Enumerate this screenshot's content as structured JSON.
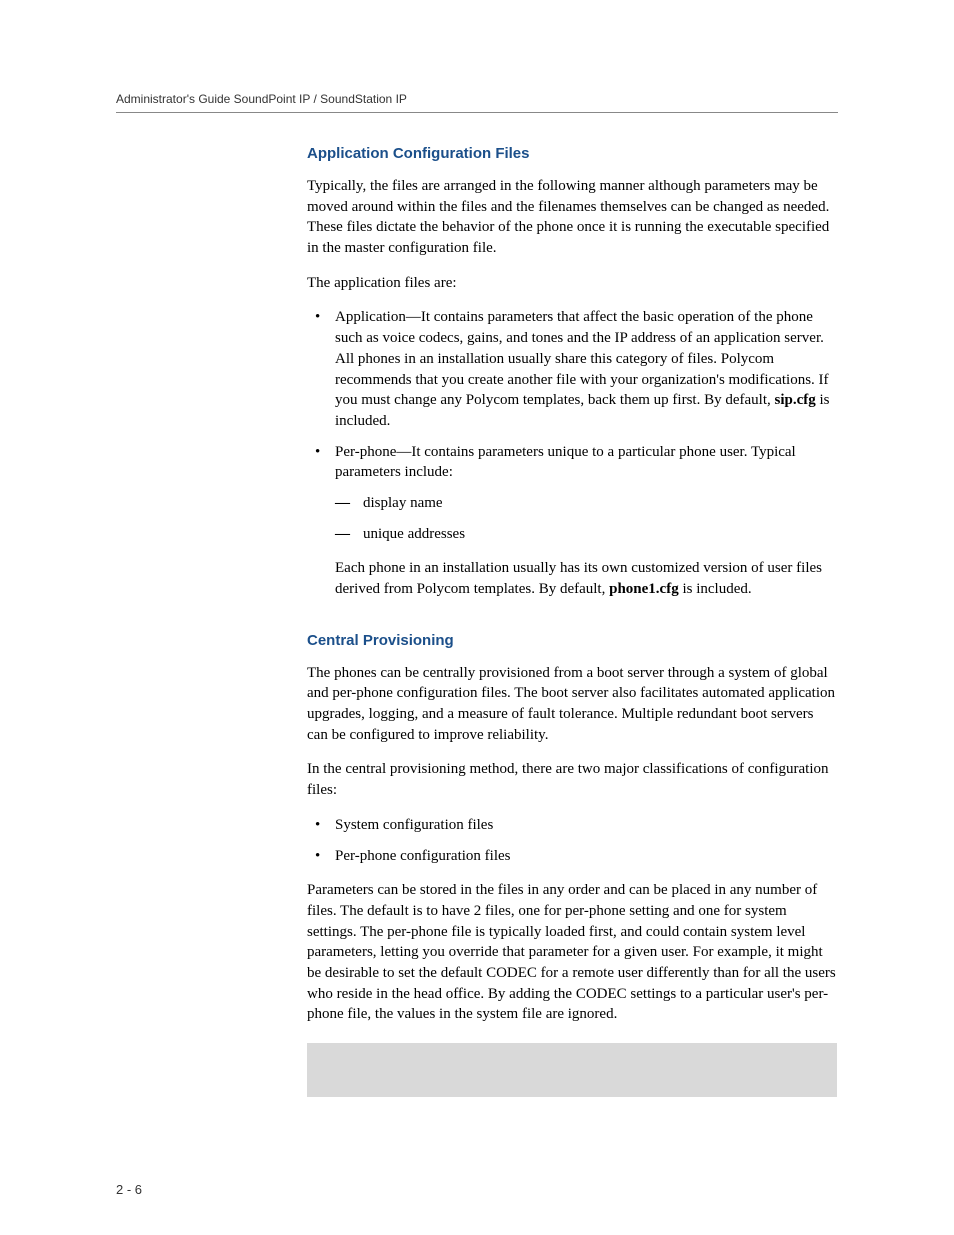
{
  "header": {
    "running_title": "Administrator's Guide SoundPoint IP / SoundStation IP"
  },
  "section1": {
    "heading": "Application Configuration Files",
    "p1": "Typically, the files are arranged in the following manner although parameters may be moved around within the files and the filenames themselves can be changed as needed. These files dictate the behavior of the phone once it is running the executable specified in the master configuration file.",
    "p2": "The application files are:",
    "bullets": [
      {
        "pre": "Application—It contains parameters that affect the basic operation of the phone such as voice codecs, gains, and tones and the IP address of an application server. All phones in an installation usually share this category of files. Polycom recommends that you create another file with your organization's modifications. If you must change any Polycom templates, back them up first. By default, ",
        "bold": "sip.cfg",
        "post": " is included."
      },
      {
        "pre": "Per-phone—It contains parameters unique to a particular phone user. Typical parameters include:",
        "sub": [
          "display name",
          "unique addresses"
        ]
      }
    ],
    "after_sub_pre": "Each phone in an installation usually has its own customized version of user files derived from Polycom templates. By default, ",
    "after_sub_bold": "phone1.cfg",
    "after_sub_post": " is included."
  },
  "section2": {
    "heading": "Central Provisioning",
    "p1": "The phones can be centrally provisioned from a boot server through a system of global and per-phone configuration files. The boot server also facilitates automated application upgrades, logging, and a measure of fault tolerance. Multiple redundant boot servers can be configured to improve reliability.",
    "p2": "In the central provisioning method, there are two major classifications of configuration files:",
    "bullets": [
      "System configuration files",
      "Per-phone configuration files"
    ],
    "p3": "Parameters can be stored in the files in any order and can be placed in any number of files. The default is to have 2 files, one for per-phone setting and one for system settings. The per-phone file is typically loaded first, and could contain system level parameters, letting you override that parameter for a given user. For example, it might be desirable to set the default CODEC for a remote user differently than for all the users who reside in the head office. By adding the CODEC settings to a particular user's per-phone file, the values in the system file are ignored."
  },
  "footer": {
    "page_number": "2 - 6"
  }
}
